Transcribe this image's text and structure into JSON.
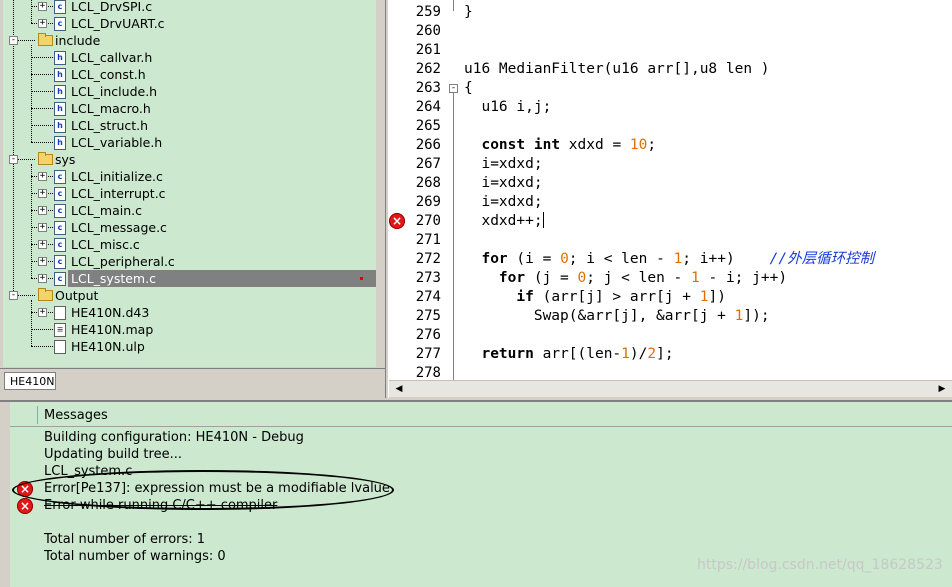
{
  "tree": {
    "items": [
      {
        "name": "LCL_DrvSPI.c",
        "depth": 2,
        "kind": "c",
        "expander": "+"
      },
      {
        "name": "LCL_DrvUART.c",
        "depth": 2,
        "kind": "c",
        "expander": "+"
      },
      {
        "name": "include",
        "depth": 1,
        "kind": "folder",
        "expander": "−"
      },
      {
        "name": "LCL_callvar.h",
        "depth": 2,
        "kind": "h",
        "expander": ""
      },
      {
        "name": "LCL_const.h",
        "depth": 2,
        "kind": "h",
        "expander": ""
      },
      {
        "name": "LCL_include.h",
        "depth": 2,
        "kind": "h",
        "expander": ""
      },
      {
        "name": "LCL_macro.h",
        "depth": 2,
        "kind": "h",
        "expander": ""
      },
      {
        "name": "LCL_struct.h",
        "depth": 2,
        "kind": "h",
        "expander": ""
      },
      {
        "name": "LCL_variable.h",
        "depth": 2,
        "kind": "h",
        "expander": ""
      },
      {
        "name": "sys",
        "depth": 1,
        "kind": "folder",
        "expander": "−"
      },
      {
        "name": "LCL_initialize.c",
        "depth": 2,
        "kind": "c",
        "expander": "+"
      },
      {
        "name": "LCL_interrupt.c",
        "depth": 2,
        "kind": "c",
        "expander": "+"
      },
      {
        "name": "LCL_main.c",
        "depth": 2,
        "kind": "c",
        "expander": "+"
      },
      {
        "name": "LCL_message.c",
        "depth": 2,
        "kind": "c",
        "expander": "+"
      },
      {
        "name": "LCL_misc.c",
        "depth": 2,
        "kind": "c",
        "expander": "+"
      },
      {
        "name": "LCL_peripheral.c",
        "depth": 2,
        "kind": "c",
        "expander": "+"
      },
      {
        "name": "LCL_system.c",
        "depth": 2,
        "kind": "c",
        "expander": "+",
        "selected": true
      },
      {
        "name": "Output",
        "depth": 1,
        "kind": "folder",
        "expander": "−"
      },
      {
        "name": "HE410N.d43",
        "depth": 2,
        "kind": "plain",
        "expander": "+"
      },
      {
        "name": "HE410N.map",
        "depth": 2,
        "kind": "map",
        "expander": ""
      },
      {
        "name": "HE410N.ulp",
        "depth": 2,
        "kind": "plain",
        "expander": ""
      }
    ],
    "tab_label": "HE410N"
  },
  "editor": {
    "lines": [
      {
        "num": "259",
        "code": "}",
        "error": false
      },
      {
        "num": "260",
        "code": "",
        "error": false
      },
      {
        "num": "261",
        "code": "",
        "error": false
      },
      {
        "num": "262",
        "code": "u16 MedianFilter(u16 arr[],u8 len )",
        "error": false
      },
      {
        "num": "263",
        "code": "{",
        "error": false
      },
      {
        "num": "264",
        "code": "  u16 i,j;",
        "error": false
      },
      {
        "num": "265",
        "code": "",
        "error": false
      },
      {
        "num": "266",
        "code": "  const int xdxd = 10;",
        "error": false
      },
      {
        "num": "267",
        "code": "  i=xdxd;",
        "error": false
      },
      {
        "num": "268",
        "code": "  i=xdxd;",
        "error": false
      },
      {
        "num": "269",
        "code": "  i=xdxd;",
        "error": false
      },
      {
        "num": "270",
        "code": "  xdxd++;",
        "error": true
      },
      {
        "num": "271",
        "code": "",
        "error": false
      },
      {
        "num": "272",
        "code": "  for (i = 0; i < len - 1; i++)    //外层循环控制",
        "error": false
      },
      {
        "num": "273",
        "code": "    for (j = 0; j < len - 1 - i; j++)",
        "error": false
      },
      {
        "num": "274",
        "code": "      if (arr[j] > arr[j + 1])",
        "error": false
      },
      {
        "num": "275",
        "code": "        Swap(&arr[j], &arr[j + 1]);",
        "error": false
      },
      {
        "num": "276",
        "code": "",
        "error": false
      },
      {
        "num": "277",
        "code": "  return arr[(len-1)/2];",
        "error": false
      },
      {
        "num": "278",
        "code": "",
        "error": false
      }
    ],
    "scroll_left_icon": "arrow-left-icon",
    "scroll_right_icon": "arrow-right-icon"
  },
  "messages": {
    "header": "Messages",
    "lines": [
      {
        "text": "Building configuration: HE410N - Debug",
        "icon": ""
      },
      {
        "text": "Updating build tree...",
        "icon": ""
      },
      {
        "text": "LCL_system.c",
        "icon": ""
      },
      {
        "text": "Error[Pe137]: expression must be a modifiable lvalue",
        "icon": "error-icon"
      },
      {
        "text": "Error while running C/C++ compiler",
        "icon": "error-icon"
      },
      {
        "text": "",
        "icon": ""
      },
      {
        "text": "Total number of errors: 1",
        "icon": ""
      },
      {
        "text": "Total number of warnings: 0",
        "icon": ""
      }
    ]
  },
  "watermark": "https://blog.csdn.net/qq_18628523",
  "colors": {
    "pane_bg": "#cce8cf",
    "error_red": "#e01818",
    "number_orange": "#e07000",
    "comment_blue": "#1a3ad8"
  }
}
